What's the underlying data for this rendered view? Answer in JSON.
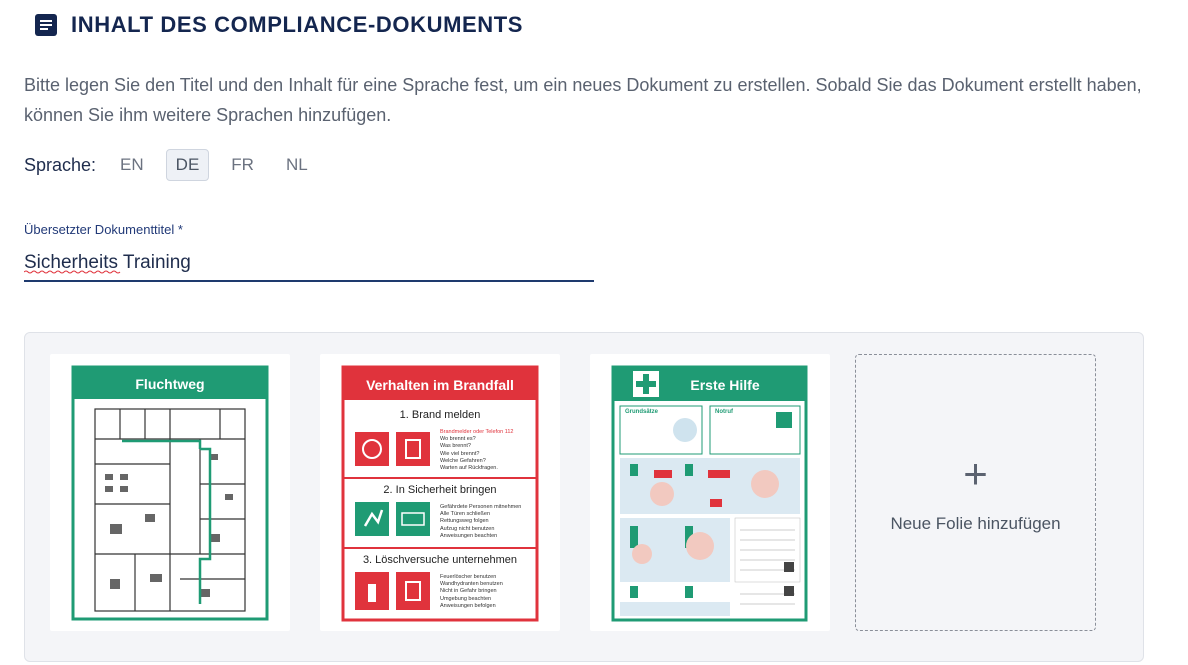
{
  "header": {
    "title": "INHALT DES COMPLIANCE-DOKUMENTS",
    "icon": "document-icon"
  },
  "description": "Bitte legen Sie den Titel und den Inhalt für eine Sprache fest, um ein neues Dokument zu erstellen. Sobald Sie das Dokument erstellt haben, können Sie ihm weitere Sprachen hinzufügen.",
  "language": {
    "label": "Sprache:",
    "options": [
      "EN",
      "DE",
      "FR",
      "NL"
    ],
    "selected": "DE"
  },
  "title_field": {
    "label": "Übersetzter Dokumenttitel *",
    "value": "Sicherheits Training"
  },
  "slides": [
    {
      "title": "Fluchtweg",
      "color": "#1f9b74"
    },
    {
      "title": "Verhalten im Brandfall",
      "color": "#e0333c",
      "sections": [
        {
          "heading": "1. Brand melden",
          "lines": [
            "Brandmelder oder Telefon 112",
            "Wo brennt es?",
            "Was brennt?",
            "Wie viel brennt?",
            "Welche Gefahren?",
            "Warten auf Rückfragen."
          ]
        },
        {
          "heading": "2. In Sicherheit bringen",
          "lines": [
            "Gefährdete Personen mitnehmen",
            "Alle Türen schließen",
            "Rettungsweg folgen",
            "Aufzug nicht benutzen",
            "Anweisungen beachten"
          ]
        },
        {
          "heading": "3. Löschversuche unternehmen",
          "lines": [
            "Feuerlöscher benutzen",
            "Wandhydranten benutzen",
            "Nicht in Gefahr bringen",
            "Umgebung beachten",
            "Anweisungen befolgen"
          ]
        }
      ]
    },
    {
      "title": "Erste Hilfe",
      "color": "#1f9b74",
      "subheadings": [
        "Grundsätze",
        "Notruf"
      ]
    }
  ],
  "add_slide": {
    "label": "Neue Folie hinzufügen",
    "icon": "plus-icon"
  }
}
